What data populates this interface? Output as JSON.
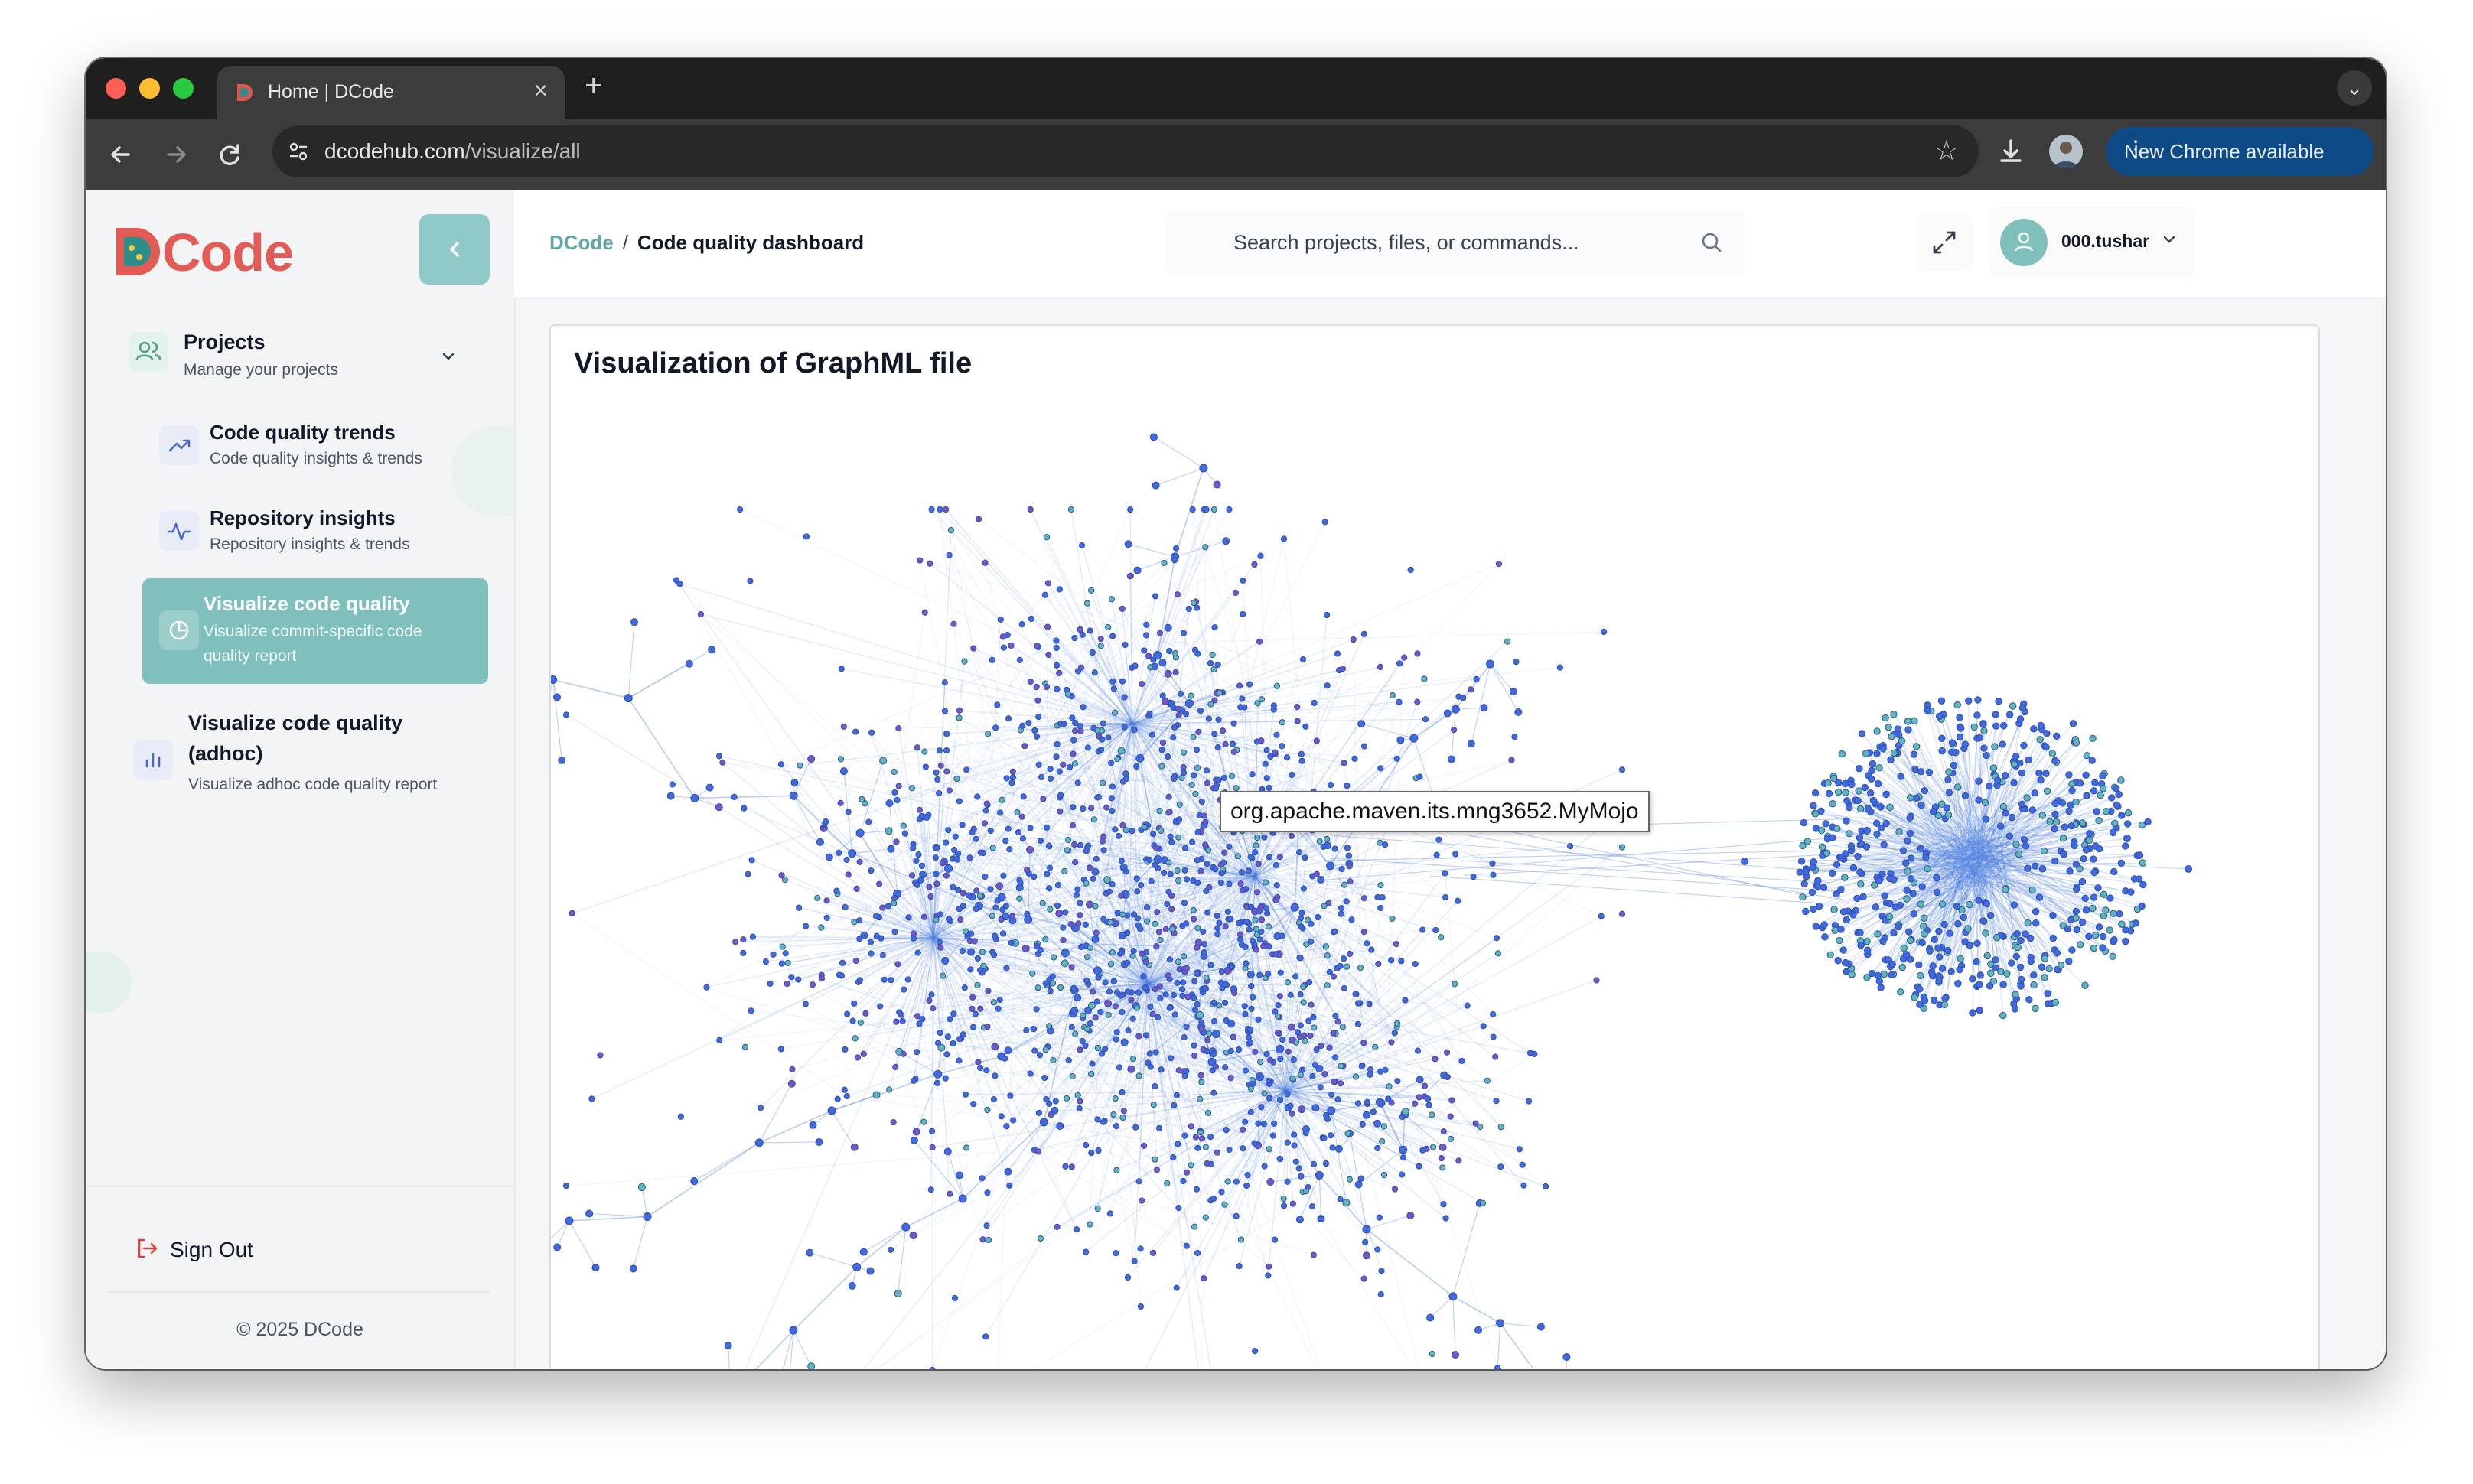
{
  "browser": {
    "tab_title": "Home | DCode",
    "url_host": "dcodehub.com",
    "url_path": "/visualize/all",
    "update_label": "New Chrome available"
  },
  "app": {
    "logo_text": "Code",
    "logo_letter": "D",
    "breadcrumb": {
      "root": "DCode",
      "separator": "/",
      "current": "Code quality dashboard"
    },
    "search_placeholder": "Search projects, files, or commands...",
    "user_name": "000.tushar"
  },
  "sidebar": {
    "projects": {
      "title": "Projects",
      "subtitle": "Manage your projects"
    },
    "items": [
      {
        "title": "Code quality trends",
        "subtitle": "Code quality insights & trends"
      },
      {
        "title": "Repository insights",
        "subtitle": "Repository insights & trends"
      },
      {
        "title": "Visualize code quality",
        "subtitle_line1": "Visualize commit-specific code",
        "subtitle_line2": "quality report"
      },
      {
        "title_line1": "Visualize code quality",
        "title_line2": "(adhoc)",
        "subtitle": "Visualize adhoc code quality report"
      }
    ],
    "sign_out": "Sign Out",
    "copyright": "© 2025 DCode"
  },
  "main": {
    "card_title": "Visualization of GraphML file",
    "tooltip": "org.apache.maven.its.mng3652.MyMojo"
  },
  "colors": {
    "accent": "#7fbfbc",
    "edge": "#4f7fe0",
    "node_blue": "#4169e1",
    "node_teal": "#5fb8b4",
    "node_purple": "#7755c8"
  }
}
